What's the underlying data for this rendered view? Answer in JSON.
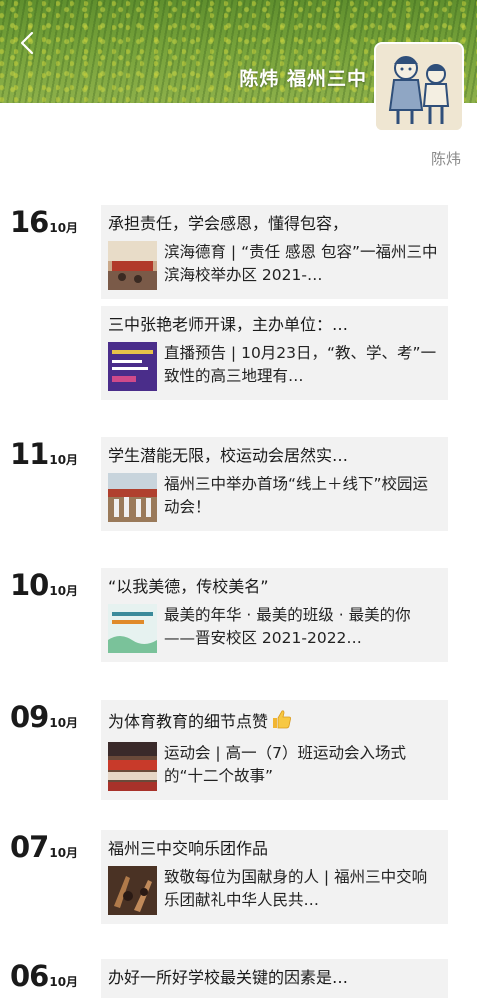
{
  "header": {
    "profile_name": "陈炜 福州三中",
    "signature": "陈炜"
  },
  "icons": {
    "back": "chevron-left-icon",
    "avatar": "children-drawing-avatar",
    "emoji": "thumbs-up-icon"
  },
  "days": [
    {
      "day": "16",
      "month": "10月",
      "posts": [
        {
          "lead": "承担责任，学会感恩，懂得包容，",
          "sub": "滨海德育 | “责任 感恩 包容”一福州三中滨海校举办区 2021-…"
        },
        {
          "lead": "三中张艳老师开课，主办单位：…",
          "sub": "直播预告 | 10月23日，“教、学、考”一致性的高三地理有…"
        }
      ]
    },
    {
      "day": "11",
      "month": "10月",
      "posts": [
        {
          "lead": "学生潜能无限，校运动会居然实…",
          "sub": "福州三中举办首场“线上＋线下”校园运动会！"
        }
      ]
    },
    {
      "day": "10",
      "month": "10月",
      "posts": [
        {
          "lead": "“以我美德，传校美名”",
          "sub": "最美的年华 · 最美的班级 · 最美的你——晋安校区 2021-2022…"
        }
      ]
    },
    {
      "day": "09",
      "month": "10月",
      "posts": [
        {
          "lead": "为体育教育的细节点赞",
          "sub": "运动会 | 高一（7）班运动会入场式的“十二个故事”"
        }
      ]
    },
    {
      "day": "07",
      "month": "10月",
      "posts": [
        {
          "lead": "福州三中交响乐团作品",
          "sub": "致敬每位为国献身的人 | 福州三中交响乐团献礼中华人民共…"
        }
      ]
    },
    {
      "day": "06",
      "month": "10月",
      "posts": [
        {
          "lead": "办好一所好学校最关键的因素是…",
          "sub": ""
        }
      ]
    }
  ]
}
